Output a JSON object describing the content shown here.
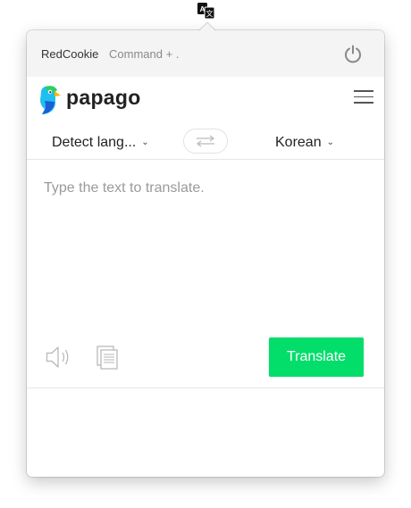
{
  "menubar": {
    "icon": "papago-translate-icon"
  },
  "topbar": {
    "app_name": "RedCookie",
    "shortcut": "Command + .",
    "power_icon": "power-icon"
  },
  "header": {
    "logo_text": "papago",
    "menu_icon": "hamburger-menu-icon"
  },
  "languages": {
    "source": "Detect lang...",
    "target": "Korean",
    "swap_icon": "swap-arrows-icon"
  },
  "input": {
    "placeholder": "Type the text to translate.",
    "value": ""
  },
  "actions": {
    "speaker_icon": "speaker-icon",
    "copy_icon": "copy-icon",
    "translate_label": "Translate"
  },
  "colors": {
    "accent": "#03de6b",
    "topbar_bg": "#f4f4f4"
  }
}
